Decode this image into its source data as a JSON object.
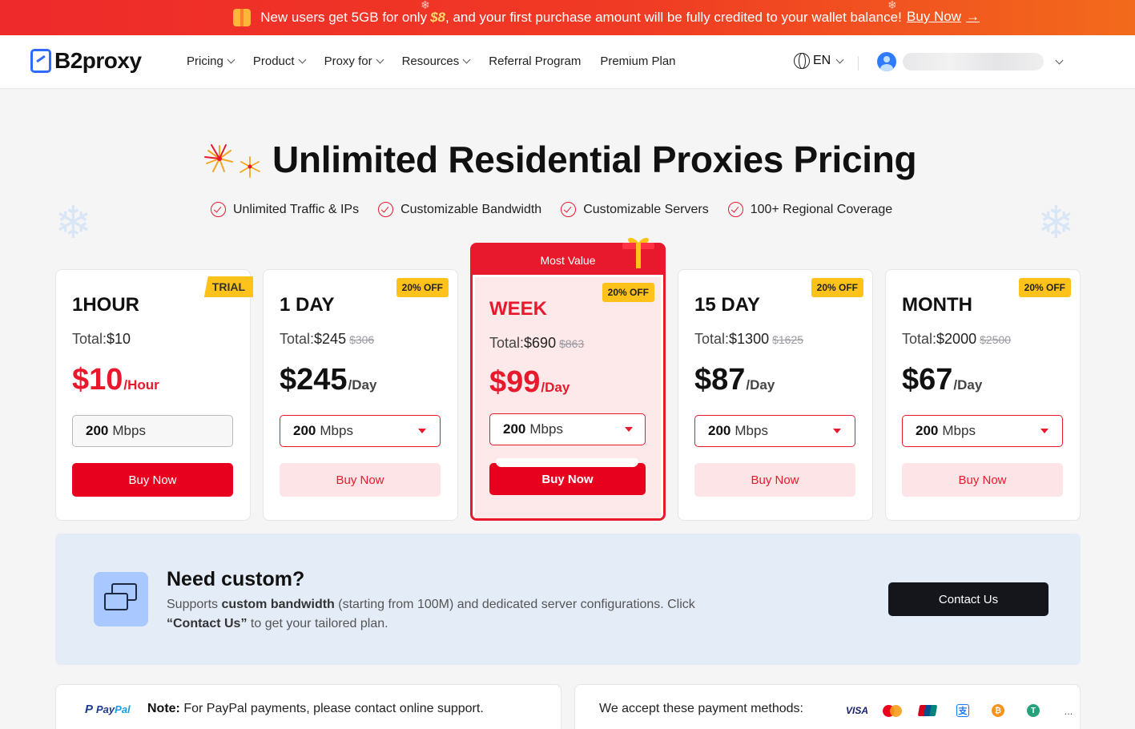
{
  "banner": {
    "text_before": "New users get 5GB for only",
    "highlight": "$8",
    "text_after": ", and your first purchase amount will be fully credited to your wallet balance!",
    "cta": "Buy Now"
  },
  "nav": {
    "logo": "B2proxy",
    "menu": [
      {
        "label": "Pricing",
        "dropdown": true
      },
      {
        "label": "Product",
        "dropdown": true
      },
      {
        "label": "Proxy for",
        "dropdown": true
      },
      {
        "label": "Resources",
        "dropdown": true
      },
      {
        "label": "Referral Program",
        "dropdown": false
      },
      {
        "label": "Premium Plan",
        "dropdown": false
      }
    ],
    "language": "EN"
  },
  "hero": {
    "title": "Unlimited Residential Proxies Pricing",
    "features": [
      "Unlimited Traffic & IPs",
      "Customizable Bandwidth",
      "Customizable Servers",
      "100+ Regional Coverage"
    ]
  },
  "plans": [
    {
      "name": "1HOUR",
      "badge": "TRIAL",
      "total_label": "Total:",
      "total": "$10",
      "original": "",
      "price": "$10",
      "unit": "/Hour",
      "bw_value": "200",
      "bw_unit": "Mbps",
      "button": "Buy Now"
    },
    {
      "name": "1 DAY",
      "badge": "20% OFF",
      "total_label": "Total:",
      "total": "$245",
      "original": "$306",
      "price": "$245",
      "unit": "/Day",
      "bw_value": "200",
      "bw_unit": "Mbps",
      "button": "Buy Now"
    },
    {
      "name": "WEEK",
      "badge": "20% OFF",
      "header": "Most Value",
      "total_label": "Total:",
      "total": "$690",
      "original": "$863",
      "price": "$99",
      "unit": "/Day",
      "bw_value": "200",
      "bw_unit": "Mbps",
      "button": "Buy Now"
    },
    {
      "name": "15 DAY",
      "badge": "20% OFF",
      "total_label": "Total:",
      "total": "$1300",
      "original": "$1625",
      "price": "$87",
      "unit": "/Day",
      "bw_value": "200",
      "bw_unit": "Mbps",
      "button": "Buy Now"
    },
    {
      "name": "MONTH",
      "badge": "20% OFF",
      "total_label": "Total:",
      "total": "$2000",
      "original": "$2500",
      "price": "$67",
      "unit": "/Day",
      "bw_value": "200",
      "bw_unit": "Mbps",
      "button": "Buy Now"
    }
  ],
  "custom": {
    "title": "Need custom?",
    "text_1": "Supports ",
    "bold_1": "custom bandwidth",
    "text_2": " (starting from 100M) and dedicated server configurations. Click ",
    "bold_2": "“Contact Us”",
    "text_3": " to get your tailored plan.",
    "button": "Contact Us"
  },
  "payment": {
    "paypal_logo_1": "Pay",
    "paypal_logo_2": "Pal",
    "note_label": "Note:",
    "note_text": " For PayPal payments, please contact online support.",
    "accept_text": "We accept these payment methods:",
    "methods": [
      "visa",
      "mastercard",
      "unionpay",
      "alipay",
      "bitcoin",
      "usdt"
    ],
    "visa_label": "VISA",
    "more": "..."
  },
  "colors": {
    "accent": "#e8192c",
    "badge": "#ffc21a",
    "banner": "#ee2a2a",
    "dark_button": "#14161c"
  }
}
